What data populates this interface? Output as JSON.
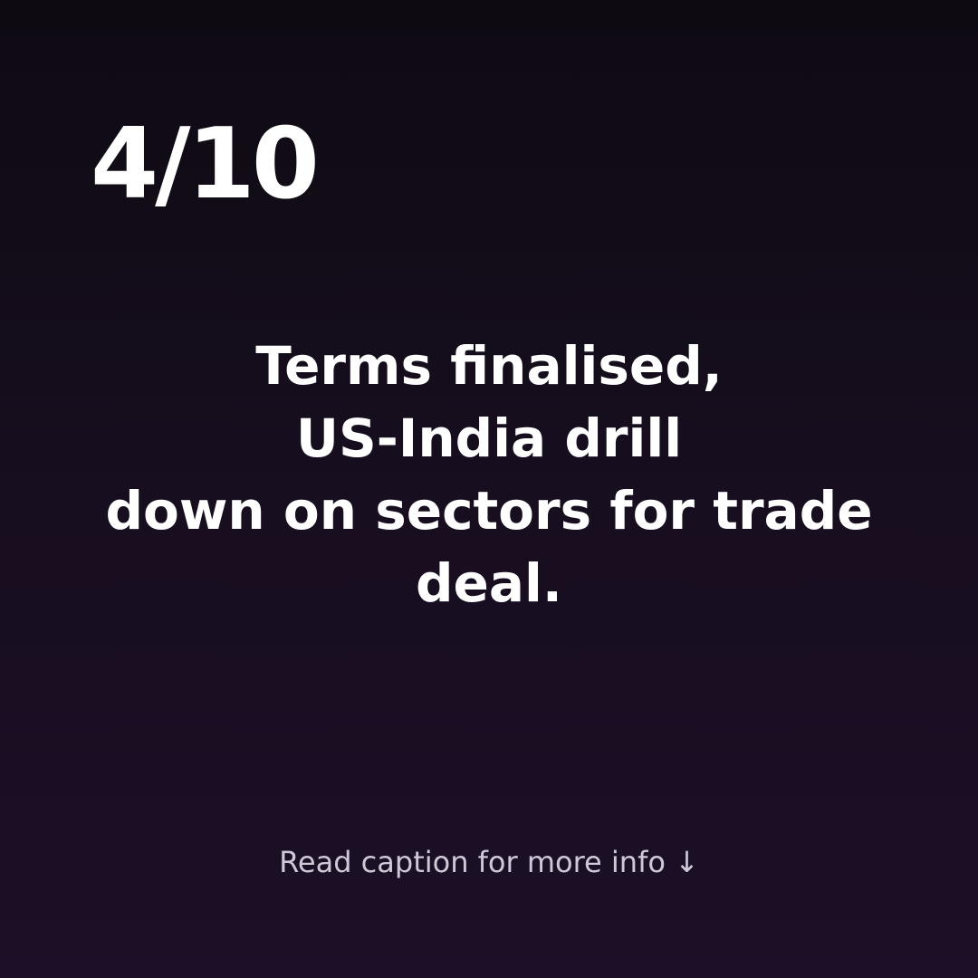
{
  "slide": {
    "counter": "4/10",
    "headline_lines": [
      "Terms finalised,",
      "US-India drill",
      "down on sectors for trade",
      "deal."
    ],
    "caption_note": "Read caption for more info ↓"
  },
  "colors": {
    "background_top": "#0e0a12",
    "background_bottom": "#1c0f27",
    "text_primary": "#ffffff",
    "text_secondary": "#cfc8d6"
  }
}
